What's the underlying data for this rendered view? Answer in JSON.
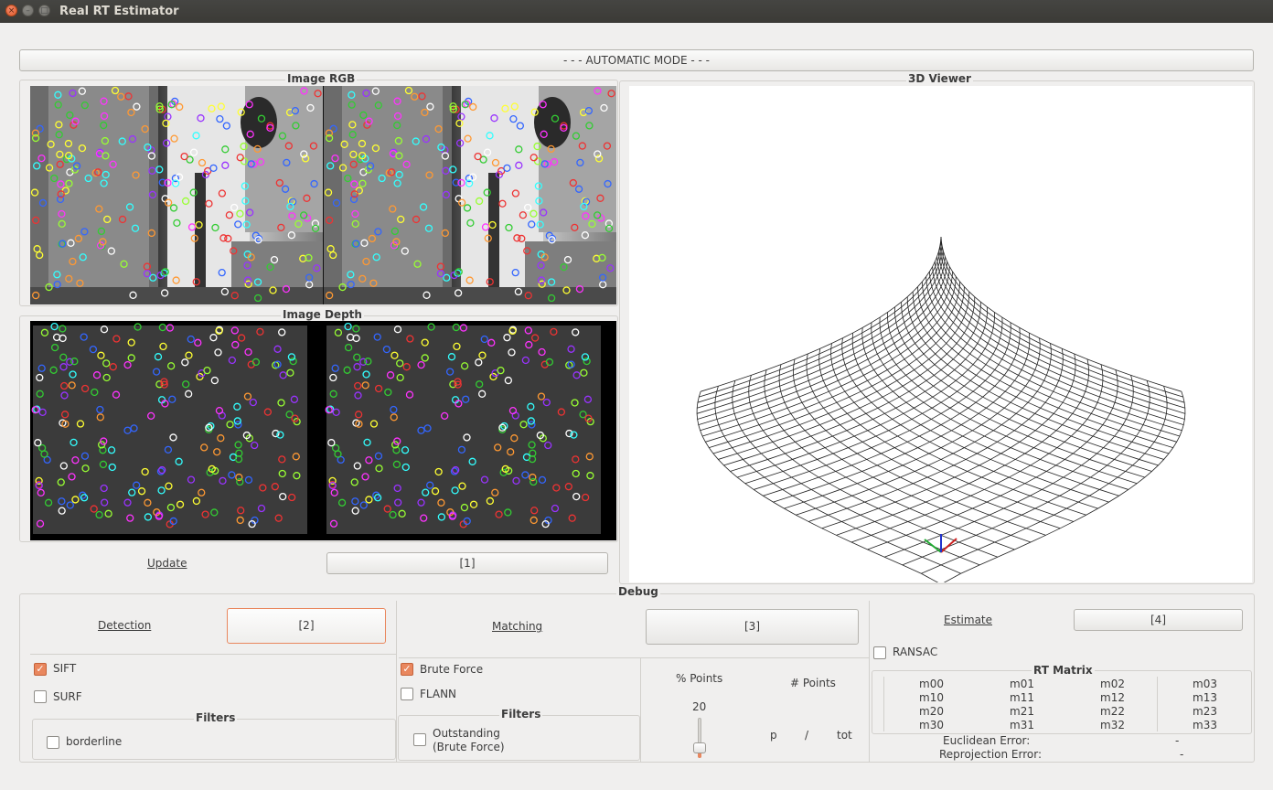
{
  "window": {
    "title": "Real RT Estimator"
  },
  "mode_button": "- - - AUTOMATIC MODE - - -",
  "image_rgb": {
    "title": "Image RGB"
  },
  "image_depth": {
    "title": "Image Depth"
  },
  "viewer": {
    "title": "3D Viewer"
  },
  "update": {
    "label": "Update",
    "button": "[1]"
  },
  "debug": {
    "title": "Debug",
    "detection": {
      "label": "Detection",
      "button": "[2]",
      "sift": "SIFT",
      "sift_checked": true,
      "surf": "SURF",
      "surf_checked": false,
      "filters_title": "Filters",
      "borderline": "borderline",
      "borderline_checked": false
    },
    "matching": {
      "label": "Matching",
      "button": "[3]",
      "brute_force": "Brute Force",
      "brute_force_checked": true,
      "flann": "FLANN",
      "flann_checked": false,
      "filters_title": "Filters",
      "outstanding_line1": "Outstanding",
      "outstanding_line2": "(Brute Force)",
      "outstanding_checked": false,
      "percent_points_label": "% Points",
      "percent_points_value": "20",
      "num_points_label": "# Points",
      "p": "p",
      "slash": "/",
      "tot": "tot"
    },
    "estimate": {
      "label": "Estimate",
      "button": "[4]",
      "ransac": "RANSAC",
      "ransac_checked": false,
      "rt_matrix_title": "RT Matrix",
      "matrix": [
        [
          "m00",
          "m01",
          "m02",
          "m03"
        ],
        [
          "m10",
          "m11",
          "m12",
          "m13"
        ],
        [
          "m20",
          "m21",
          "m22",
          "m23"
        ],
        [
          "m30",
          "m31",
          "m32",
          "m33"
        ]
      ],
      "euclidean_label": "Euclidean Error:",
      "euclidean_value": "-",
      "reprojection_label": "Reprojection Error:",
      "reprojection_value": "-"
    }
  }
}
